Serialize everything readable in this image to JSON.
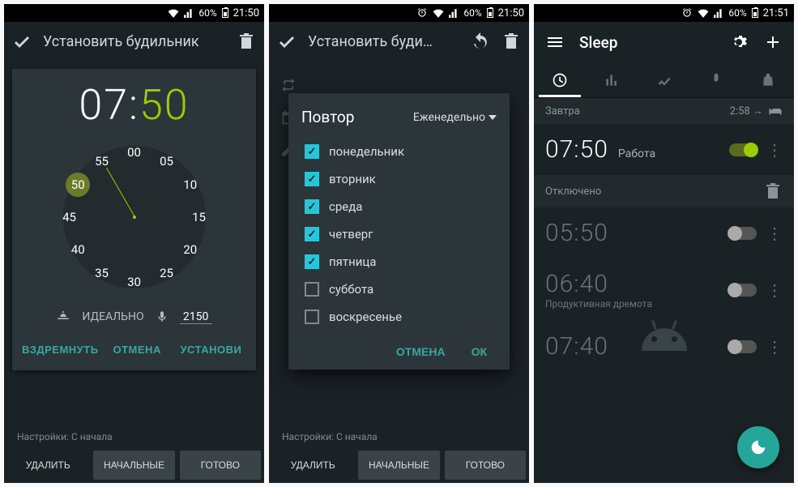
{
  "colors": {
    "accent": "#9ccc00",
    "teal": "#3aa89e",
    "bg": "#1b2226",
    "card": "#2c3539"
  },
  "p1": {
    "status": {
      "battery": "60%",
      "time": "21:50"
    },
    "title": "Установить будильник",
    "time_hour": "07",
    "time_sep": ":",
    "time_minute": "50",
    "clock_numbers": [
      "00",
      "05",
      "10",
      "15",
      "20",
      "25",
      "30",
      "35",
      "40",
      "45",
      "50",
      "55"
    ],
    "clock_selected": "50",
    "ideal_label": "ИДЕАЛЬНО",
    "voice_value": "2150",
    "actions": {
      "nap": "ВЗДРЕМНУТЬ",
      "cancel": "ОТМЕНА",
      "set": "УСТАНОВИ"
    },
    "bg_settings": "Настройки: С начала",
    "bottom": {
      "delete": "УДАЛИТЬ",
      "initial": "НАЧАЛЬНЫЕ",
      "done": "ГОТОВО"
    }
  },
  "p2": {
    "status": {
      "battery": "60%",
      "time": "21:50"
    },
    "title": "Установить буди…",
    "dialog_title": "Повтор",
    "dropdown": "Еженедельно",
    "days": [
      {
        "label": "понедельник",
        "checked": true
      },
      {
        "label": "вторник",
        "checked": true
      },
      {
        "label": "среда",
        "checked": true
      },
      {
        "label": "четверг",
        "checked": true
      },
      {
        "label": "пятница",
        "checked": true
      },
      {
        "label": "суббота",
        "checked": false
      },
      {
        "label": "воскресенье",
        "checked": false
      }
    ],
    "cancel": "ОТМЕНА",
    "ok": "ОК",
    "bg_settings": "Настройки: С начала",
    "bottom": {
      "delete": "УДАЛИТЬ",
      "initial": "НАЧАЛЬНЫЕ",
      "done": "ГОТОВО"
    }
  },
  "p3": {
    "status": {
      "battery": "60%",
      "time": "21:51"
    },
    "app_title": "Sleep",
    "section": {
      "label": "Завтра",
      "eta": "2:58 →"
    },
    "alarms_on": [
      {
        "time": "07:50",
        "label": "Работа",
        "on": true
      }
    ],
    "section_off": "Отключено",
    "alarms_off": [
      {
        "time": "05:50",
        "label": "",
        "on": false
      },
      {
        "time": "06:40",
        "label": "Продуктивная дремота",
        "on": false
      },
      {
        "time": "07:40",
        "label": "",
        "on": false
      }
    ]
  }
}
